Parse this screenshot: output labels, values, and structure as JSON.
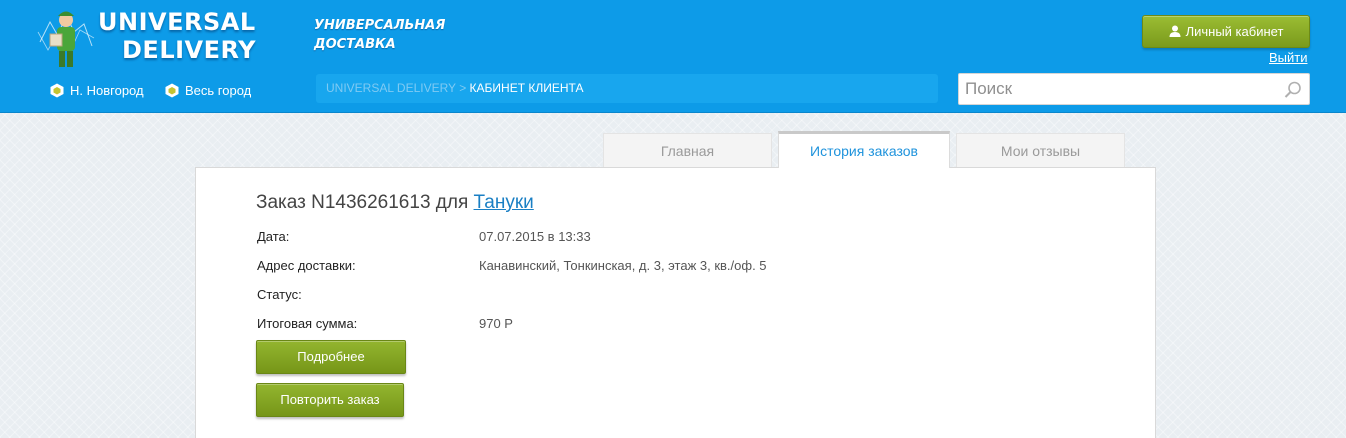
{
  "header": {
    "logo": {
      "line1": "UNIVERSAL",
      "line2": "DELIVERY"
    },
    "tagline": {
      "line1": "УНИВЕРСАЛЬНАЯ",
      "line2": "ДОСТАВКА"
    },
    "cities": [
      {
        "label": "Н. Новгород"
      },
      {
        "label": "Весь город"
      }
    ],
    "breadcrumb": {
      "root": "UNIVERSAL DELIVERY",
      "separator": ">",
      "current": "КАБИНЕТ КЛИЕНТА"
    },
    "account_button_label": "Личный кабинет",
    "logout_label": "Выйти",
    "search": {
      "placeholder": "Поиск",
      "value": ""
    },
    "colors": {
      "header_bg": "#0d9be8",
      "button_green": "#86a823"
    }
  },
  "tabs": [
    {
      "label": "Главная",
      "active": false
    },
    {
      "label": "История заказов",
      "active": true
    },
    {
      "label": "Мои отзывы",
      "active": false
    }
  ],
  "order": {
    "title_prefix": "Заказ N1436261613 для",
    "restaurant": "Тануки",
    "fields": [
      {
        "label": "Дата:",
        "value": "07.07.2015 в 13:33"
      },
      {
        "label": "Адрес доставки:",
        "value": "Канавинский, Тонкинская, д. 3, этаж 3, кв./оф. 5"
      },
      {
        "label": "Статус:",
        "value": ""
      },
      {
        "label": "Итоговая сумма:",
        "value": "970 Р"
      }
    ],
    "details_button": "Подробнее",
    "repeat_button": "Повторить заказ"
  }
}
